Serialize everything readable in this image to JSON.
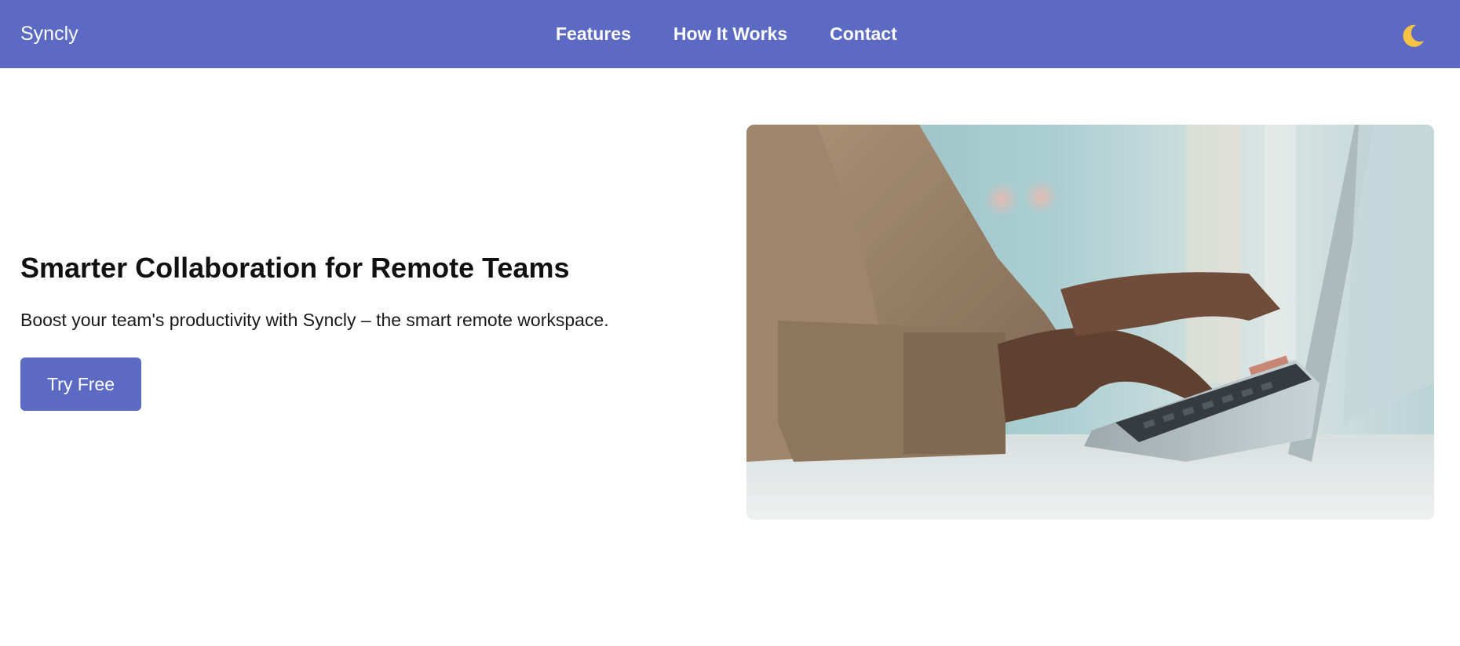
{
  "header": {
    "brand": "Syncly",
    "nav": [
      {
        "label": "Features"
      },
      {
        "label": "How It Works"
      },
      {
        "label": "Contact"
      }
    ],
    "theme_toggle_icon": "moon-icon"
  },
  "hero": {
    "title": "Smarter Collaboration for Remote Teams",
    "subtitle": "Boost your team's productivity with Syncly – the smart remote workspace.",
    "cta_label": "Try Free",
    "image_icon": "laptop-typing-photo"
  },
  "colors": {
    "brand": "#5c6ac4",
    "nav_text": "#ffffff",
    "moon": "#f6c343"
  }
}
